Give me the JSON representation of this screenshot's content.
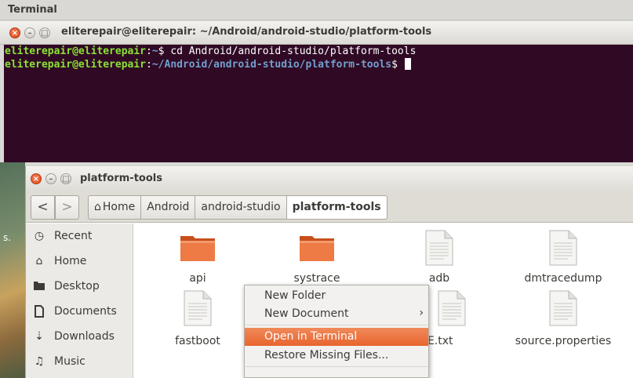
{
  "app_bar": {
    "title": "Terminal"
  },
  "terminal": {
    "title": "eliterepair@eliterepair: ~/Android/android-studio/platform-tools",
    "lines": [
      {
        "user": "eliterepair@eliterepair",
        "sep": ":",
        "path": "~",
        "prompt": "$ ",
        "command": "cd Android/android-studio/platform-tools"
      },
      {
        "user": "eliterepair@eliterepair",
        "sep": ":",
        "path": "~/Android/android-studio/platform-tools",
        "prompt": "$ ",
        "command": ""
      }
    ]
  },
  "desktop": {
    "fragment": "s."
  },
  "files_window": {
    "title": "platform-tools",
    "nav": {
      "back": "<",
      "forward": ">"
    },
    "breadcrumbs": [
      "Home",
      "Android",
      "android-studio",
      "platform-tools"
    ],
    "sidebar": [
      {
        "label": "Recent",
        "icon": "clock-icon"
      },
      {
        "label": "Home",
        "icon": "home-icon"
      },
      {
        "label": "Desktop",
        "icon": "desktop-folder-icon"
      },
      {
        "label": "Documents",
        "icon": "document-icon"
      },
      {
        "label": "Downloads",
        "icon": "download-icon"
      },
      {
        "label": "Music",
        "icon": "music-icon"
      }
    ],
    "files": [
      {
        "name": "api",
        "type": "folder"
      },
      {
        "name": "systrace",
        "type": "folder"
      },
      {
        "name": "adb",
        "type": "file"
      },
      {
        "name": "dmtracedump",
        "type": "file"
      },
      {
        "name": "fastboot",
        "type": "file"
      },
      {
        "name": "TICE.txt",
        "type": "file"
      },
      {
        "name": "source.properties",
        "type": "file"
      }
    ],
    "folder_color": "#e8642e"
  },
  "context_menu": {
    "items": [
      {
        "label": "New Folder",
        "submenu": false
      },
      {
        "label": "New Document",
        "submenu": true
      },
      {
        "label": "Open in Terminal",
        "highlighted": true
      },
      {
        "label": "Restore Missing Files...",
        "submenu": false
      }
    ],
    "highlight_color": "#e8642e"
  },
  "colors": {
    "terminal_bg": "#300a24",
    "prompt_user": "#8ae234",
    "prompt_path": "#729fcf"
  }
}
